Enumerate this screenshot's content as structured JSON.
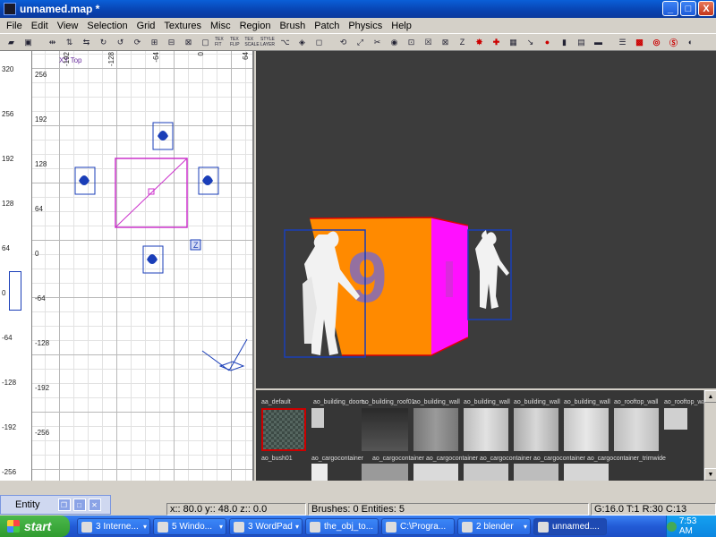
{
  "window": {
    "title": "unnamed.map *",
    "minimize": "_",
    "maximize": "□",
    "close": "X"
  },
  "menu": [
    "File",
    "Edit",
    "View",
    "Selection",
    "Grid",
    "Textures",
    "Misc",
    "Region",
    "Brush",
    "Patch",
    "Physics",
    "Help"
  ],
  "toolbar_icons": [
    "open-icon",
    "save-icon",
    "flip-x-icon",
    "flip-y-icon",
    "flip-z-icon",
    "rotate-x-icon",
    "rotate-y-icon",
    "rotate-z-icon",
    "select-complete-tall-icon",
    "select-touching-icon",
    "select-partial-tall-icon",
    "select-inside-icon",
    "csg-subtract-icon",
    "csg-merge-icon",
    "hollow-icon",
    "texture-rotate-icon",
    "scale-icon",
    "clipper-icon",
    "camera-icon",
    "change-views-icon",
    "show-entities-icon",
    "texture-lock-icon",
    "cubic-clip-icon",
    "light-icon",
    "cull-icon",
    "patch-icon"
  ],
  "toolbar_text": {
    "tex1": "TEX FIT",
    "tex2": "TEX FLIP",
    "tex3": "TEX SCALE",
    "style": "STYLE LAYER"
  },
  "ruler_v": [
    "320",
    "256",
    "192",
    "128",
    "64",
    "0",
    "-64",
    "-128",
    "-192",
    "-256"
  ],
  "grid": {
    "view_label": "XY Top",
    "y_ticks": [
      "256",
      "192",
      "128",
      "64",
      "0",
      "-64",
      "-128",
      "-192",
      "-256"
    ],
    "x_ticks": [
      "-192",
      "-128",
      "-64",
      "0",
      "64"
    ],
    "entity_marker": "Z"
  },
  "textures": {
    "row1": [
      "aa_default",
      "ao_building_doort...",
      "ao_building_roof01",
      "ao_building_wall",
      "ao_building_wall",
      "ao_building_wall",
      "ao_building_wall",
      "ao_rooftop_wall",
      "ao_rooftop_wall"
    ],
    "row2": [
      "ao_bush01",
      "ao_cargocontainer",
      "ao_cargocontainer",
      "ao_cargocontainer",
      "ao_cargocontainer",
      "ao_cargocontainer",
      "ao_cargocontainer_trimwide"
    ]
  },
  "entity_panel": {
    "title": "Entity"
  },
  "status": {
    "coords": "x:: 80.0  y:: 48.0  z:: 0.0",
    "counts": "Brushes: 0 Entities: 5",
    "grid": "G:16.0 T:1 R:30 C:13"
  },
  "taskbar": {
    "start": "start",
    "tasks": [
      "3 Interne...",
      "5 Windo...",
      "3 WordPad",
      "the_obj_to...",
      "C:\\Progra...",
      "2 blender",
      "unnamed...."
    ],
    "time": "7:53 AM"
  },
  "colors": {
    "brush_face": "#ff8a00",
    "brush_side": "#ff10ff",
    "selection": "#1a3eb8",
    "brush_2d": "#cc33cc"
  }
}
